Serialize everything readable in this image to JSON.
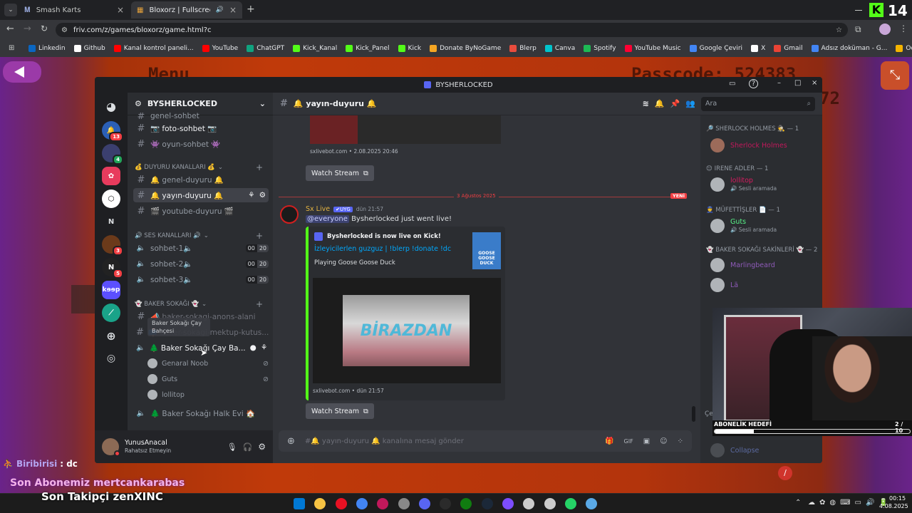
{
  "browser": {
    "tabs": [
      {
        "label": "Smash Karts",
        "active": false
      },
      {
        "label": "Bloxorz | Fullscreen | No Ad",
        "active": true
      }
    ],
    "url": "friv.com/z/games/bloxorz/game.html?c",
    "bookmarks": [
      "Linkedin",
      "Github",
      "Kanal kontrol paneli...",
      "YouTube",
      "ChatGPT",
      "Kick_Kanal",
      "Kick_Panel",
      "Kick",
      "Donate ByNoGame",
      "Blerp",
      "Canva",
      "Spotify",
      "YouTube Music",
      "Google Çeviri",
      "X",
      "Gmail",
      "Adsız doküman - G...",
      "Oda Oluştur | İsim Ş..."
    ],
    "bookmark_colors": [
      "#0a66c2",
      "#ffffff",
      "#ff0000",
      "#ff0000",
      "#10a37f",
      "#53fc18",
      "#53fc18",
      "#53fc18",
      "#f5a623",
      "#e84c3d",
      "#00c4cc",
      "#1db954",
      "#ff0033",
      "#4285f4",
      "#ffffff",
      "#ea4335",
      "#4285f4",
      "#f4b400"
    ],
    "kick_count": "14"
  },
  "game": {
    "hud_left": "Menu",
    "hud_right": "Passcode: 524383",
    "hud_right2": "72"
  },
  "discord": {
    "window_title": "BYSHERLOCKED",
    "server_name": "BYSHERLOCKED",
    "guild_letter": "N",
    "guild_keep": "kɘɘp",
    "guild_badges": [
      "13",
      "4",
      "3",
      "5"
    ],
    "channels": {
      "top_cut": "genel-sohbet",
      "foto": "📷 foto-sohbet 📷",
      "oyun": "👾 oyun-sohbet 👾",
      "cat_duyuru": "💰 DUYURU KANALLARI 💰",
      "genel_duyuru": "🔔 genel-duyuru 🔔",
      "yayin_duyuru": "🔔 yayın-duyuru 🔔",
      "youtube_duyuru": "🎬 youtube-duyuru 🎬",
      "cat_ses": "🔊 SES KANALLARI 🔊",
      "voice": [
        {
          "name": "sohbet-1🔈",
          "count": "00",
          "limit": "20"
        },
        {
          "name": "sohbet-2🔈",
          "count": "00",
          "limit": "20"
        },
        {
          "name": "sohbet-3🔈",
          "count": "00",
          "limit": "20"
        }
      ],
      "cat_baker": "👻 BAKER SOKAĞI 👻",
      "baker_anons": "📣 baker-sokagi-anons-alani",
      "baker_mektup": "📫 baker-sokagi-mektup-kutus...",
      "drag_tooltip": "Baker Sokağı Çay Bahçesi",
      "baker_cay": "🌲 Baker Sokağı Çay Ba...",
      "voice_users": [
        "Genaral Noob",
        "Guts",
        "lollitop"
      ],
      "halk_evi": "🌲 Baker Sokağı Halk Evi 🏠"
    },
    "user_panel": {
      "name": "YunusAnacal",
      "status": "Rahatsız Etmeyin"
    },
    "chat": {
      "channel": "🔔 yayın-duyuru 🔔",
      "search_placeholder": "Ara",
      "embed1_footer": "sxlivebot.com • 2.08.2025 20:46",
      "watch_stream": "Watch Stream",
      "date_divider": "3 Ağustos 2025",
      "new_badge": "YENİ",
      "author": "Sx Live",
      "app_badge": "✔UYG",
      "time": "dün 21:57",
      "mention": "@everyone",
      "message": "Bysherlocked just went live!",
      "embed2_author": "Bysherlocked is now live on Kick!",
      "embed2_title": "İzleyicilerlen guzguz | !blerp !donate !dc",
      "embed2_desc": "Playing Goose Goose Duck",
      "thumb_text": "GOOSE GOOSE DUCK",
      "image_text": "BİRAZDAN",
      "embed2_footer": "sxlivebot.com • dün 21:57",
      "input_placeholder": "#🔔 yayın-duyuru 🔔 kanalına mesaj gönder"
    },
    "members": {
      "cat1": "🔎 SHERLOCK HOLMES 🕵️ — 1",
      "m1": "Sherlock Holmes",
      "cat2": "😊 IRENE ADLER — 1",
      "m2": "lollitop",
      "m2_sub": "🔊 Sesli aramada",
      "cat3": "👮 MÜFETTİŞLER 📄 — 1",
      "m3": "Guts",
      "m3_sub": "🔊 Sesli aramada",
      "cat4": "👻 BAKER SOKAĞI SAKİNLERİ 👻 — 2",
      "m4": "Marlingbeard",
      "m5": "Lä",
      "cut_label": "Çe",
      "collapse": "Collapse"
    }
  },
  "stream_overlay": {
    "sub_goal_label": "ABONELİK HEDEFİ",
    "sub_goal_value": "2 / 10",
    "sub_goal_progress": 0.2,
    "chat_line_user": "Biribirisi",
    "chat_line_msg": ": dc",
    "last_sub": "Son Abonemiz mertcankarabas",
    "last_follow": "Son Takipçi zenXINC"
  },
  "taskbar": {
    "time": "00:15",
    "date": "4.08.2025",
    "app_colors": [
      "#0078d4",
      "#f6c343",
      "#e81123",
      "#4285f4",
      "#c2185b",
      "#888888",
      "#5865f2",
      "#2b2b2b",
      "#107c10",
      "#1b2838",
      "#7c4dff",
      "#cccccc",
      "#cccccc",
      "#25d366",
      "#5aa9e6"
    ]
  },
  "colors": {
    "discord_bg": "#313338",
    "kick_green": "#53fc18",
    "blurple": "#5865f2",
    "dnd_red": "#f23f43",
    "online_green": "#23a55a"
  }
}
